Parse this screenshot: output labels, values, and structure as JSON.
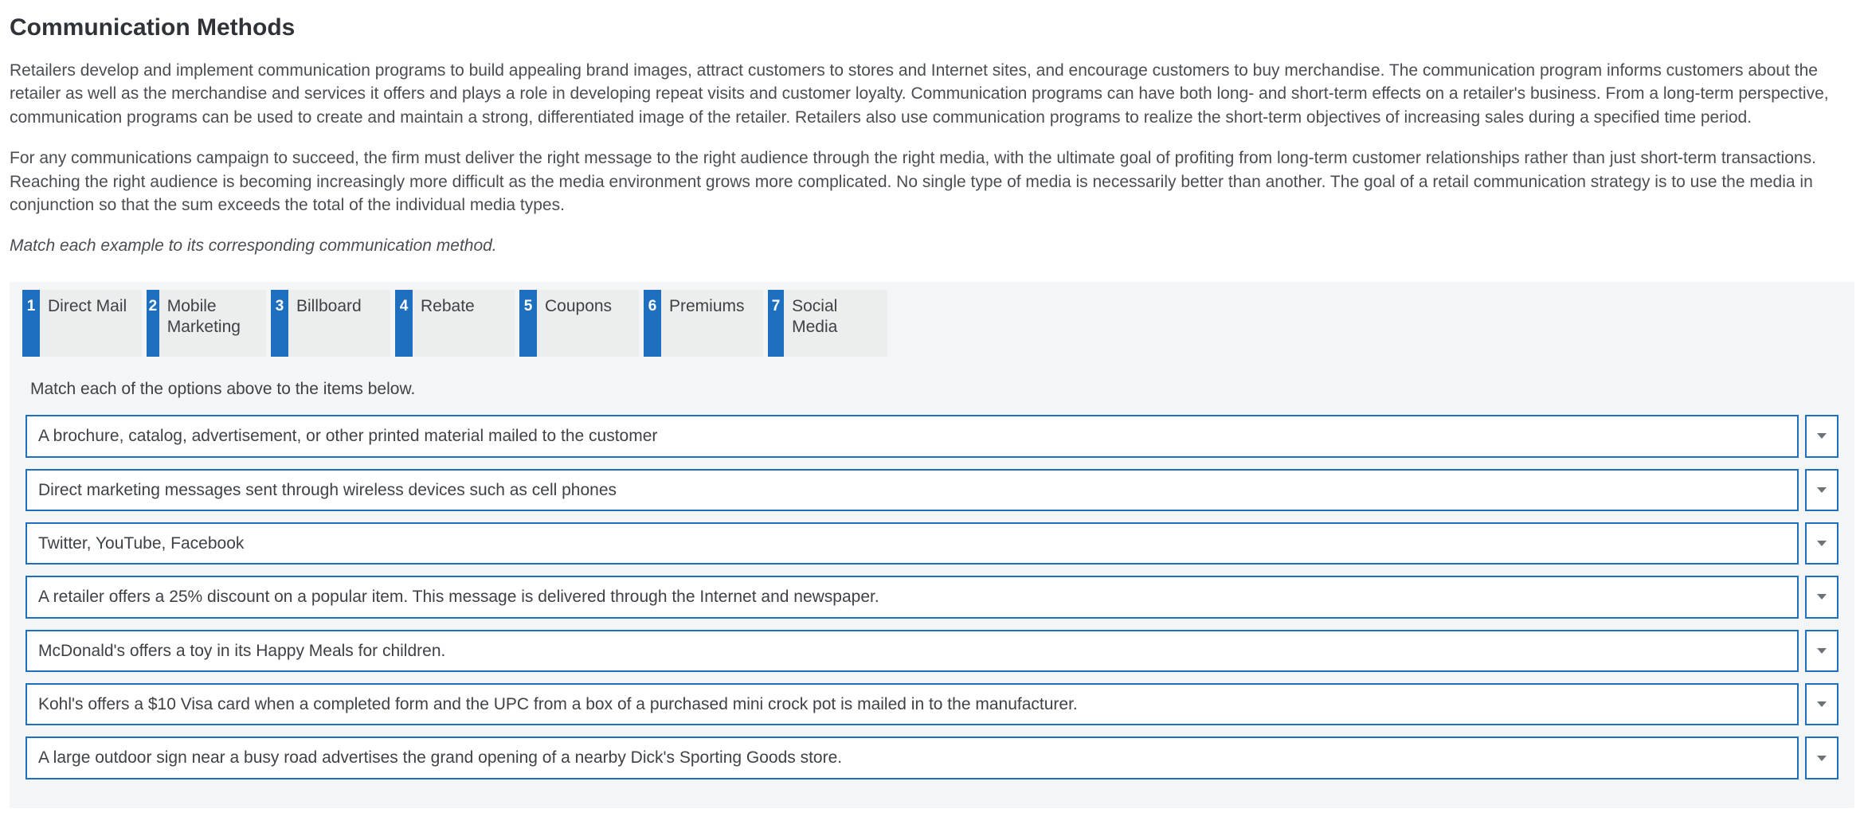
{
  "title": "Communication Methods",
  "paragraphs": [
    "Retailers develop and implement communication programs to build appealing brand images, attract customers to stores and Internet sites, and encourage customers to buy merchandise. The communication program informs customers about the retailer as well as the merchandise and services it offers and plays a role in developing repeat visits and customer loyalty. Communication programs can have both long- and short-term effects on a retailer's business. From a long-term perspective, communication programs can be used to create and maintain a strong, differentiated image of the retailer. Retailers also use communication programs to realize the short-term objectives of increasing sales during a specified time period.",
    "For any communications campaign to succeed, the firm must deliver the right message to the right audience through the right media, with the ultimate goal of profiting from long-term customer relationships rather than just short-term transactions. Reaching the right audience is becoming increasingly more difficult as the media environment grows more complicated. No single type of media is necessarily better than another. The goal of a retail communication strategy is to use the media in conjunction so that the sum exceeds the total of the individual media types."
  ],
  "instruction": "Match each example to its corresponding communication method.",
  "options": [
    {
      "num": "1",
      "label": "Direct Mail"
    },
    {
      "num": "2",
      "label": "Mobile Marketing"
    },
    {
      "num": "3",
      "label": "Billboard"
    },
    {
      "num": "4",
      "label": "Rebate"
    },
    {
      "num": "5",
      "label": "Coupons"
    },
    {
      "num": "6",
      "label": "Premiums"
    },
    {
      "num": "7",
      "label": "Social Media"
    }
  ],
  "match_header": "Match each of the options above to the items below.",
  "items": [
    "A brochure, catalog, advertisement, or other printed material mailed to the customer",
    "Direct marketing messages sent through wireless devices such as cell phones",
    "Twitter, YouTube, Facebook",
    "A retailer offers a 25% discount on a popular item. This message is delivered through the Internet and newspaper.",
    "McDonald's offers a toy in its Happy Meals for children.",
    "Kohl's offers a $10 Visa card when a completed form and the UPC from a box of a purchased mini crock pot is mailed in to the manufacturer.",
    "A large outdoor sign near a busy road advertises the grand opening of a nearby Dick's Sporting Goods store."
  ]
}
